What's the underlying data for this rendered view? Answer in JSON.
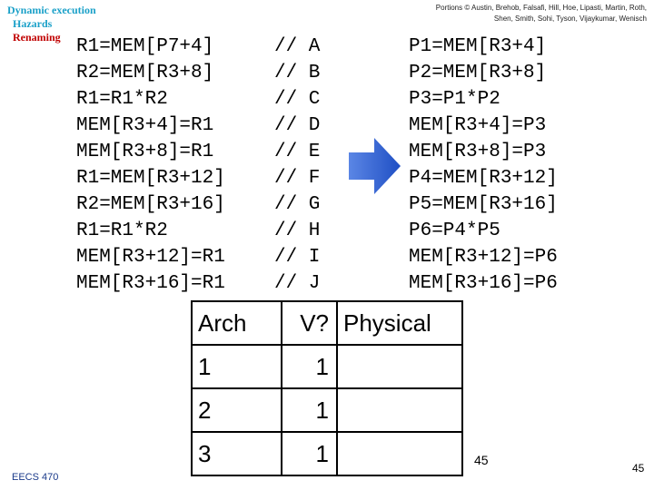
{
  "nav": {
    "section": "Dynamic execution",
    "subsection": "Hazards",
    "current": "Renaming",
    "section_color": "#1aa0c8",
    "current_color": "#c00000"
  },
  "credit": {
    "line1": "Portions © Austin, Brehob, Falsafi, Hill, Hoe, Lipasti, Martin, Roth,",
    "line2": "Shen, Smith, Sohi, Tyson, Vijaykumar, Wenisch"
  },
  "original_code": [
    "R1=MEM[P7+4]",
    "R2=MEM[R3+8]",
    "R1=R1*R2",
    "MEM[R3+4]=R1",
    "MEM[R3+8]=R1",
    "R1=MEM[R3+12]",
    "R2=MEM[R3+16]",
    "R1=R1*R2",
    "MEM[R3+12]=R1",
    "MEM[R3+16]=R1"
  ],
  "comments": [
    "// A",
    "// B",
    "// C",
    "// D",
    "// E",
    "// F",
    "// G",
    "// H",
    "// I",
    "// J"
  ],
  "renamed_code": [
    "P1=MEM[R3+4]",
    "P2=MEM[R3+8]",
    "P3=P1*P2",
    "MEM[R3+4]=P3",
    "MEM[R3+8]=P3",
    "P4=MEM[R3+12]",
    "P5=MEM[R3+16]",
    "P6=P4*P5",
    "MEM[R3+12]=P6",
    "MEM[R3+16]=P6"
  ],
  "arrow_color": "#2d5fd0",
  "table": {
    "headers": [
      "Arch",
      "V?",
      "Physical"
    ],
    "rows": [
      [
        "1",
        "1",
        ""
      ],
      [
        "2",
        "1",
        ""
      ],
      [
        "3",
        "1",
        ""
      ]
    ]
  },
  "footer": {
    "course": "EECS 470",
    "page_center": "45",
    "page_right": "45"
  }
}
